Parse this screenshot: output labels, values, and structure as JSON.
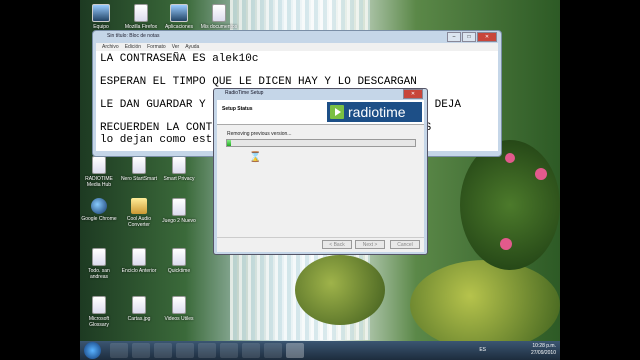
{
  "desktop": {
    "top_icons": [
      {
        "label": "Equipo",
        "icon": "computer-icon"
      },
      {
        "label": "Mozilla Firefox",
        "icon": "document-icon"
      },
      {
        "label": "Aplicaciones",
        "icon": "monitor-icon"
      },
      {
        "label": "Mis documentos",
        "icon": "document-icon"
      }
    ],
    "icons": [
      {
        "label": "RADIOTIME Media Hub",
        "icon": "document-icon"
      },
      {
        "label": "Nero StartSmart",
        "icon": "document-icon"
      },
      {
        "label": "Smart Privacy",
        "icon": "document-icon"
      },
      {
        "label": "Google Chrome",
        "icon": "chrome-icon"
      },
      {
        "label": "Cool Audio Converter",
        "icon": "folder-icon"
      },
      {
        "label": "Juego 2 Nuevo",
        "icon": "document-icon"
      },
      {
        "label": "Todo. san andreas",
        "icon": "document-icon"
      },
      {
        "label": "Enciclo Anterior",
        "icon": "document-icon"
      },
      {
        "label": "Quicktime",
        "icon": "document-icon"
      },
      {
        "label": "Microsoft Glossary",
        "icon": "document-icon"
      },
      {
        "label": "Cartas.jpg",
        "icon": "document-icon"
      },
      {
        "label": "Videos Utiles",
        "icon": "document-icon"
      }
    ]
  },
  "notepad": {
    "title": "Sin título: Bloc de notas",
    "menu": [
      "Archivo",
      "Edición",
      "Formato",
      "Ver",
      "Ayuda"
    ],
    "lines": [
      "LA CONTRASEÑA ES alek10c",
      "ESPERAN EL TIMPO QUE LE DICEN HAY Y LO DESCARGAN",
      "LE DAN GUARDAR Y",
      "RECUERDEN LA CONT",
      "lo dejan como est"
    ],
    "line2_hidden_tail": "NO ME DEJA",
    "line4_hidden_tail": "AS"
  },
  "setup": {
    "title": "RadioTime Setup",
    "heading": "Setup Status",
    "logo_text": "radiotime",
    "message": "Removing previous version...",
    "progress": 0.02,
    "buttons": {
      "back": "< Back",
      "next": "Next >",
      "cancel": "Cancel"
    }
  },
  "taskbar": {
    "language": "ES",
    "time": "10:28 p.m.",
    "date": "27/09/2010"
  }
}
